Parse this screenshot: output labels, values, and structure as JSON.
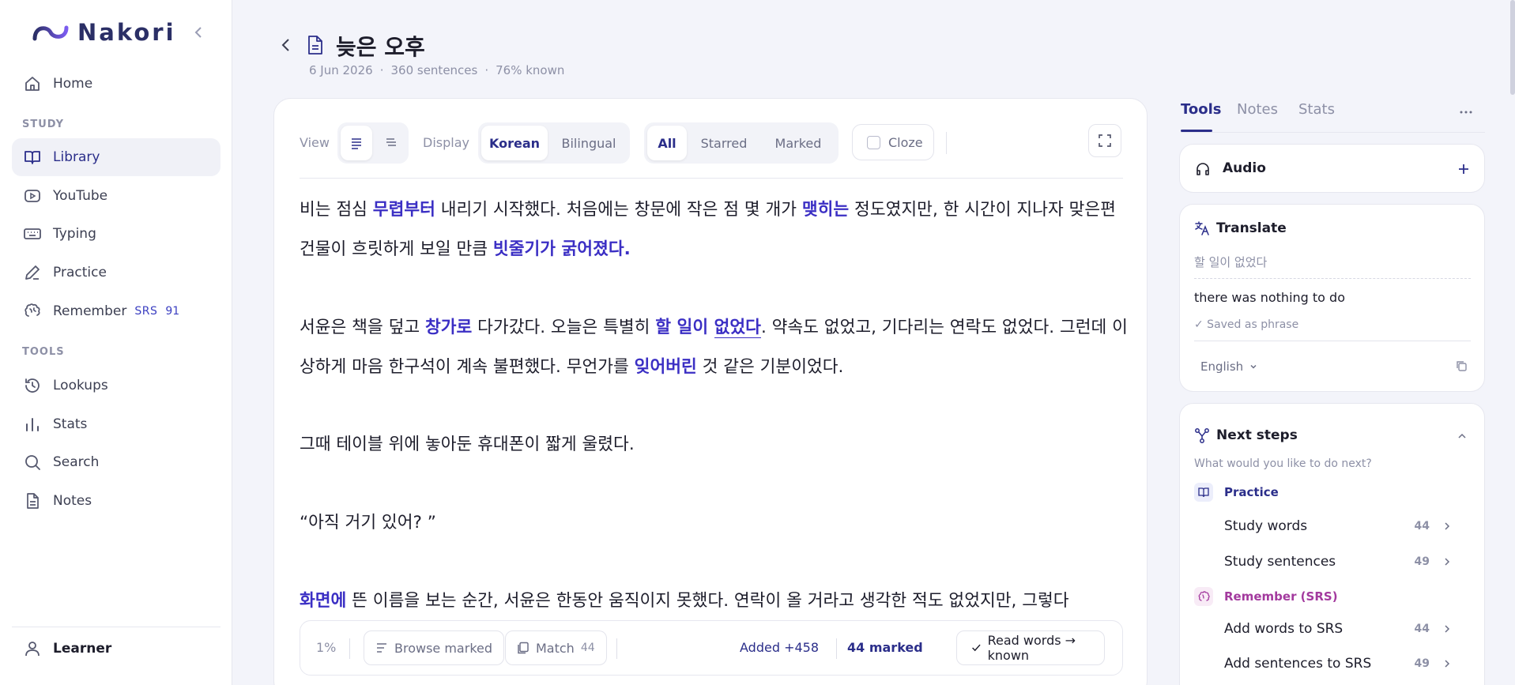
{
  "app": {
    "name": "Nakori"
  },
  "sidebar": {
    "items": [
      {
        "label": "Home",
        "icon": "home-icon"
      },
      {
        "label": "Library",
        "icon": "book-icon",
        "active": true
      },
      {
        "label": "YouTube",
        "icon": "youtube-icon"
      },
      {
        "label": "Typing",
        "icon": "keyboard-icon"
      },
      {
        "label": "Practice",
        "icon": "pencil-icon"
      },
      {
        "label": "Remember",
        "icon": "brain-icon",
        "badge": "SRS",
        "count": "91"
      },
      {
        "label": "Lookups",
        "icon": "history-icon"
      },
      {
        "label": "Stats",
        "icon": "bar-chart-icon"
      },
      {
        "label": "Search",
        "icon": "search-icon"
      },
      {
        "label": "Notes",
        "icon": "notes-icon"
      }
    ],
    "sections": {
      "study": "STUDY",
      "tools": "TOOLS"
    },
    "user": {
      "label": "Learner"
    }
  },
  "header": {
    "title": "늦은 오후",
    "date": "6 Jun 2026",
    "sentences": "360 sentences",
    "known": "76% known",
    "sep": "·"
  },
  "toolbar": {
    "view_label": "View",
    "display_label": "Display",
    "display_options": [
      "Korean",
      "Bilingual"
    ],
    "display_selected": "Korean",
    "filter_options": [
      "All",
      "Starred",
      "Marked"
    ],
    "filter_selected": "All",
    "cloze_label": "Cloze"
  },
  "reader": {
    "p1": {
      "a": "비는 점심 ",
      "b": "무렵부터",
      "c": " 내리기 시작했다. 처음에는 창문에 작은 점 몇 개가 ",
      "d": "맺히는",
      "e": " 정도였지만, 한 시간이 지나자 맞은편 건물이 흐릿하게 보일 만큼 ",
      "f": "빗줄기가 굵어졌다."
    },
    "p2": {
      "a": "서윤은 책을 덮고 ",
      "b": "창가로",
      "c": " 다가갔다. 오늘은 특별히 ",
      "d1": "할 일이 ",
      "d2": "없었다",
      "e": ". 약속도 없었고, 기다리는 연락도 없었다. 그런데 이상하게 마음 한구석이 계속 불편했다. 무언가를 ",
      "f": "잊어버린",
      "g": " 것 같은 기분이었다."
    },
    "p3": "그때 테이블 위에 놓아둔 휴대폰이 짧게 울렸다.",
    "p4": "“아직 거기 있어? ”",
    "p5": {
      "a": "화면에",
      "b": " 뜬 이름을 보는 순간, 서윤은 한동안 움직이지 못했다. 연락이 올 거라고 생각한 적도 없었지만, 그렇다"
    }
  },
  "bottombar": {
    "progress": "1%",
    "browse_marked": "Browse marked",
    "match_label": "Match",
    "match_count": "44",
    "added": "Added +458",
    "marked": "44 marked",
    "read_known": "Read words → known"
  },
  "right_panel": {
    "tabs": [
      "Tools",
      "Notes",
      "Stats"
    ],
    "active_tab": "Tools",
    "audio": {
      "title": "Audio"
    },
    "translate": {
      "title": "Translate",
      "source": "할 일이 없었다",
      "result": "there was nothing to do",
      "saved": "✓ Saved as phrase",
      "language": "English"
    },
    "next_steps": {
      "title": "Next steps",
      "prompt": "What would you like to do next?",
      "practice": {
        "label": "Practice",
        "items": [
          {
            "label": "Study words",
            "count": "44"
          },
          {
            "label": "Study sentences",
            "count": "49"
          }
        ]
      },
      "remember": {
        "label": "Remember (SRS)",
        "items": [
          {
            "label": "Add words to SRS",
            "count": "44"
          },
          {
            "label": "Add sentences to SRS",
            "count": "49"
          }
        ]
      }
    }
  },
  "colors": {
    "accent": "#3b2fc4",
    "srs": "#a33a9e",
    "bg": "#f3f4fa"
  }
}
